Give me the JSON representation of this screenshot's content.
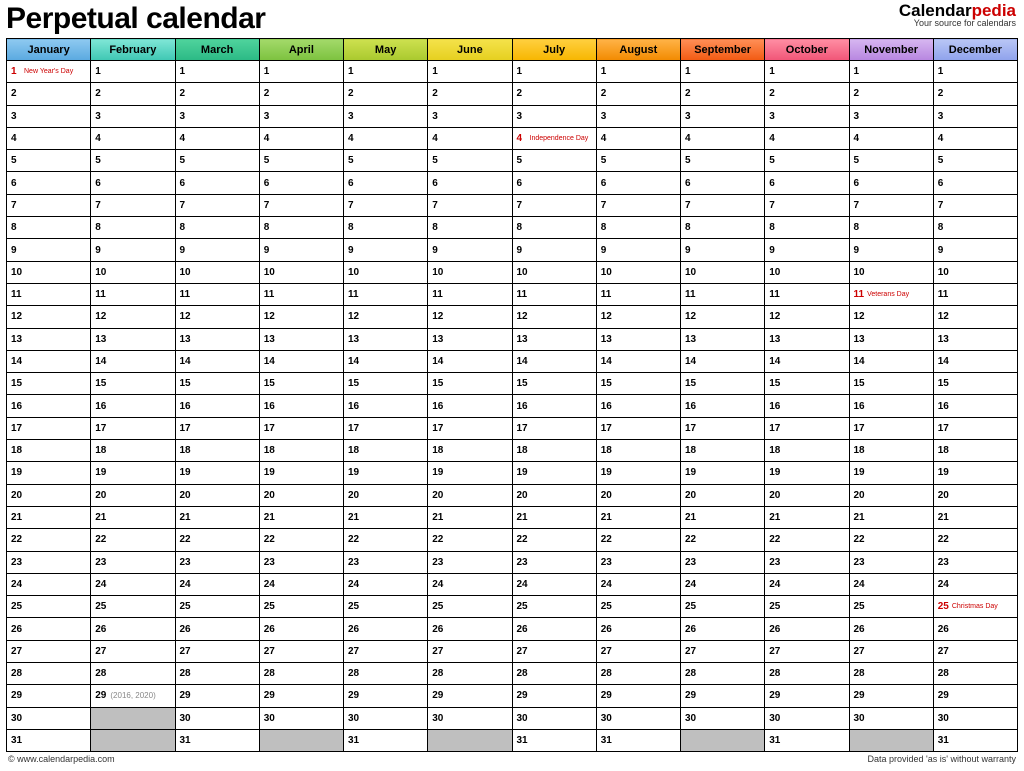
{
  "title": "Perpetual calendar",
  "brand": {
    "name_a": "Calendar",
    "name_b": "pedia",
    "tagline": "Your source for calendars"
  },
  "footer": {
    "left": "© www.calendarpedia.com",
    "right": "Data provided 'as is' without warranty"
  },
  "months": [
    {
      "name": "January",
      "days": 31
    },
    {
      "name": "February",
      "days": 29,
      "leap_note_day": 29,
      "leap_note": "(2016, 2020)"
    },
    {
      "name": "March",
      "days": 31
    },
    {
      "name": "April",
      "days": 30
    },
    {
      "name": "May",
      "days": 31
    },
    {
      "name": "June",
      "days": 30
    },
    {
      "name": "July",
      "days": 31
    },
    {
      "name": "August",
      "days": 31
    },
    {
      "name": "September",
      "days": 30
    },
    {
      "name": "October",
      "days": 31
    },
    {
      "name": "November",
      "days": 30
    },
    {
      "name": "December",
      "days": 31
    }
  ],
  "max_rows": 31,
  "holidays": [
    {
      "month": 0,
      "day": 1,
      "name": "New Year's Day"
    },
    {
      "month": 6,
      "day": 4,
      "name": "Independence Day"
    },
    {
      "month": 10,
      "day": 11,
      "name": "Veterans Day"
    },
    {
      "month": 11,
      "day": 25,
      "name": "Christmas Day"
    }
  ]
}
